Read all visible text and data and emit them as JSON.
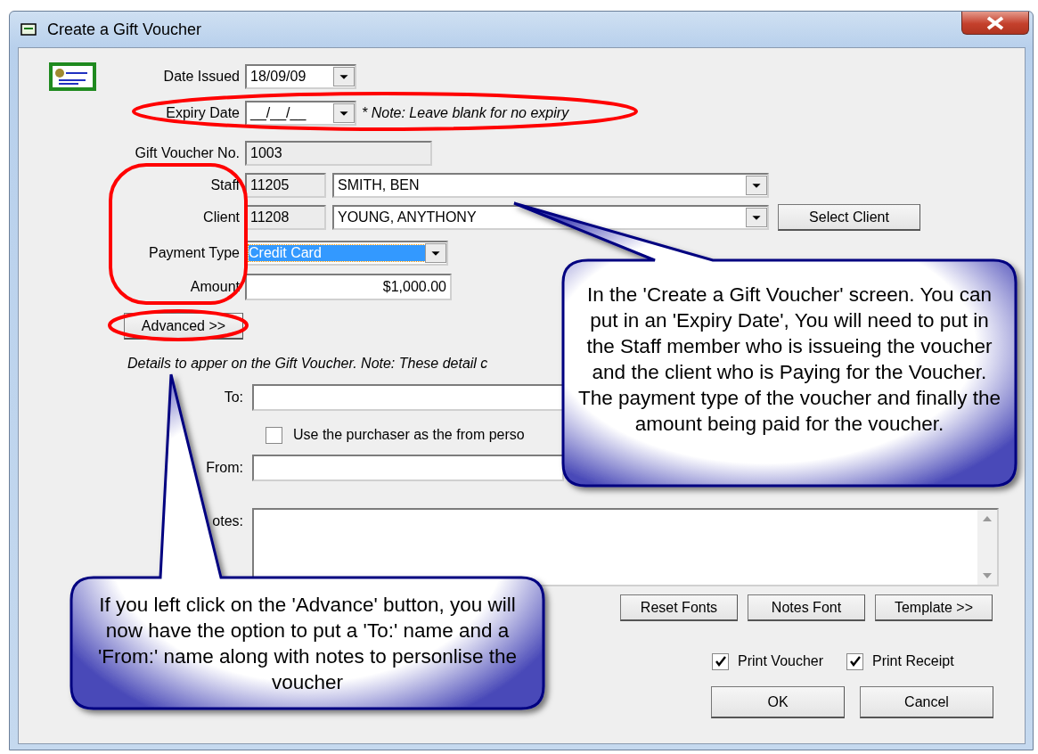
{
  "window": {
    "title": "Create a Gift Voucher"
  },
  "date_issued": {
    "label": "Date Issued",
    "value": "18/09/09"
  },
  "expiry_date": {
    "label": "Expiry Date",
    "value": "__/__/__",
    "note": "* Note: Leave blank for no expiry"
  },
  "voucher_no": {
    "label": "Gift Voucher No.",
    "value": "1003"
  },
  "staff": {
    "label": "Staff",
    "id": "11205",
    "name": "SMITH, BEN"
  },
  "client": {
    "label": "Client",
    "id": "11208",
    "name": "YOUNG, ANYTHONY",
    "button": "Select Client"
  },
  "payment_type": {
    "label": "Payment Type",
    "value": "Credit Card",
    "highlighted": true
  },
  "amount": {
    "label": "Amount",
    "value": "$1,000.00"
  },
  "advanced_button": "Advanced >>",
  "details_note": "Details to apper on the Gift Voucher. Note: These detail c",
  "to": {
    "label": "To:"
  },
  "use_purchaser": {
    "label": "Use the purchaser as the from perso",
    "checked": false
  },
  "from": {
    "label": "From:"
  },
  "notes": {
    "label": "otes:"
  },
  "font_buttons": [
    "Reset Fonts",
    "Notes Font",
    "Template >>"
  ],
  "print_options": [
    {
      "label": "Print Voucher",
      "checked": true
    },
    {
      "label": "Print Receipt",
      "checked": true
    }
  ],
  "dialog_buttons": [
    "OK",
    "Cancel"
  ],
  "callouts": [
    {
      "text": "In the 'Create a Gift Voucher' screen. You can put in an 'Expiry Date', You will need to put in the Staff member who is issueing the voucher and the client who is Paying for the Voucher. The payment type of the voucher and finally the amount being paid for the voucher."
    },
    {
      "text": "If you left click on the 'Advance' button, you will now have the option to put a 'To:' name and a 'From:' name along with notes to personlise the voucher"
    }
  ]
}
